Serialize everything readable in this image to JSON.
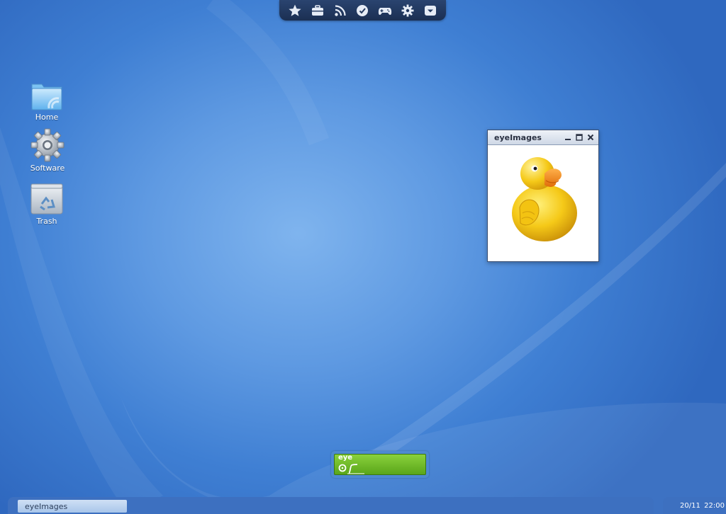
{
  "top_dock": {
    "icons": [
      "star-icon",
      "briefcase-icon",
      "rss-icon",
      "clock-icon",
      "gamepad-icon",
      "gear-icon",
      "download-icon"
    ]
  },
  "desktop_icons": [
    {
      "label": "Home",
      "icon": "folder-icon"
    },
    {
      "label": "Software",
      "icon": "gear-icon"
    },
    {
      "label": "Trash",
      "icon": "trash-icon"
    }
  ],
  "window": {
    "title": "eyeImages",
    "image": "rubber-duck"
  },
  "launcher": {
    "text": "eye"
  },
  "taskbar": {
    "task_label": "eyeImages"
  },
  "clock": {
    "date": "20/11",
    "time": "22:00"
  },
  "colors": {
    "desktop_blue": "#5f9ae2",
    "dock_dark": "#1b2f52",
    "launcher_green": "#6cbb22",
    "duck_yellow": "#f5c918",
    "beak_orange": "#f08a12"
  }
}
